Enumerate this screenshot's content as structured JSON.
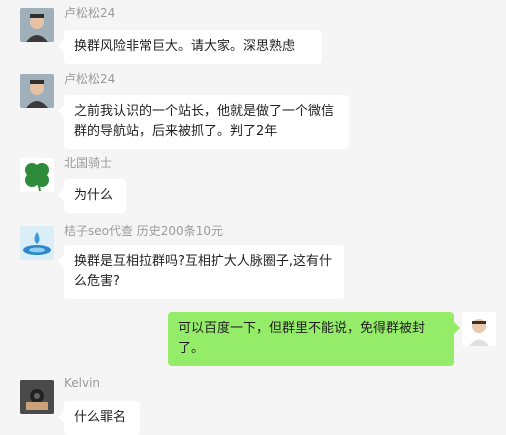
{
  "messages": [
    {
      "sender": "卢松松24",
      "text": "换群风险非常巨大。请大家。深思熟虑"
    },
    {
      "sender": "卢松松24",
      "text": "之前我认识的一个站长，他就是做了一个微信群的导航站，后来被抓了。判了2年"
    },
    {
      "sender": "北国骑士",
      "text": "为什么"
    },
    {
      "sender": "桔子seo代查 历史200条10元",
      "text": "换群是互相拉群吗?互相扩大人脉圈子,这有什么危害?"
    },
    {
      "sender": "",
      "text": "可以百度一下，但群里不能说，免得群被封了。"
    },
    {
      "sender": "Kelvin",
      "text": "什么罪名"
    }
  ],
  "colors": {
    "self_bubble": "#95ec69",
    "other_bubble": "#ffffff",
    "background": "#f5f5f5"
  },
  "icons": {
    "clover_avatar": "clover-icon",
    "water_drop_avatar": "water-drop-icon"
  }
}
